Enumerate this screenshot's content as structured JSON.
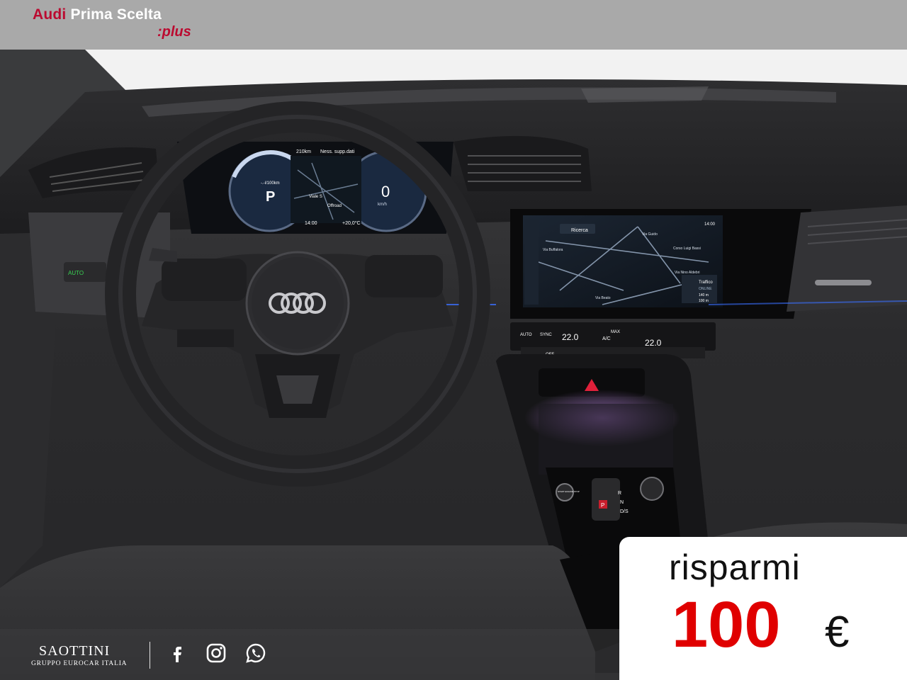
{
  "header": {
    "brand_audi": "Audi",
    "brand_rest": "Prima Scelta",
    "brand_plus": ":plus"
  },
  "cluster": {
    "range": "210km",
    "nav_status": "Ness. supp.dati",
    "consumption": "-.-l/100km",
    "speed": "0",
    "speed_unit": "km/h",
    "gear": "P",
    "drive_mode": "Offroad",
    "time": "14:00",
    "temp": "+20,0°C",
    "street": "Viale S"
  },
  "mmi": {
    "time": "14:00",
    "search": "Ricerca",
    "street1": "Via Buffalora",
    "street2": "Corso Luigi Bassi",
    "street3": "Via Nino Aldebri",
    "street4": "Via Guido",
    "street5": "Via Beato",
    "traffic_title": "Traffico",
    "traffic_status": "ONLINE",
    "scale_1": "140 m",
    "scale_2": "100 m"
  },
  "climate": {
    "auto": "AUTO",
    "sync": "SYNC",
    "off": "OFF",
    "temp_left": "22.0",
    "temp_right": "22.0",
    "ac": "A/C",
    "max": "MAX"
  },
  "console": {
    "start_stop": "START ENGINE STOP",
    "gear_r": "R",
    "gear_n": "N",
    "gear_ds": "D/S",
    "park": "P"
  },
  "footer": {
    "dealer_name": "SAOTTINI",
    "dealer_sub": "GRUPPO EUROCAR ITALIA"
  },
  "badge": {
    "label": "risparmi",
    "amount": "100",
    "currency": "€"
  },
  "colors": {
    "audi_red": "#bb0a30",
    "price_red": "#e00000"
  },
  "icons": [
    "facebook-icon",
    "instagram-icon",
    "whatsapp-icon",
    "audi-rings-logo"
  ]
}
